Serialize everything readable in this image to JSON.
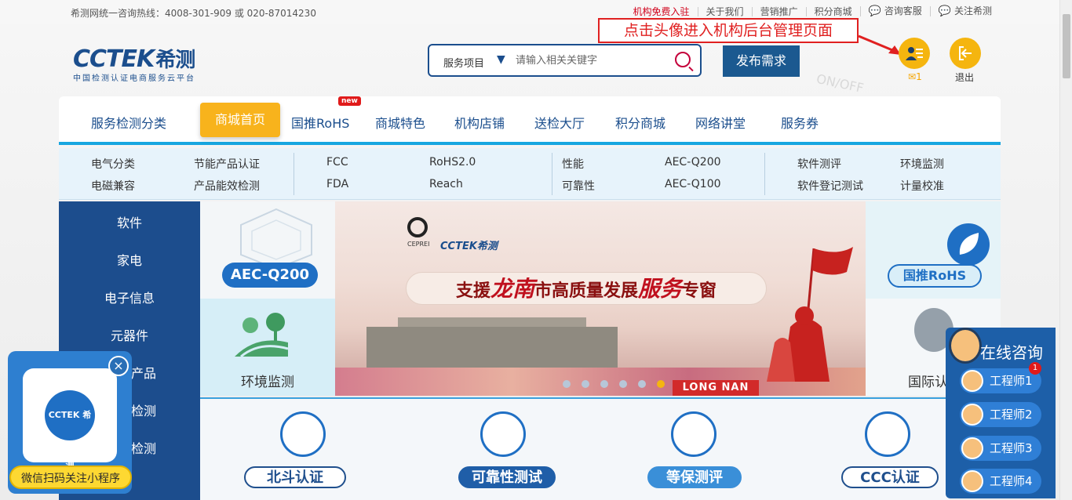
{
  "topbar": {
    "hotline": "希测网统一咨询热线：4008-301-909 或 020-87014230",
    "links": [
      "机构免费入驻",
      "关于我们",
      "营销推广",
      "积分商城"
    ],
    "consult": "咨询客服",
    "follow": "关注希测"
  },
  "logo": {
    "mark": "CCTEK",
    "cn": "希测",
    "tagline": "中国检测认证电商服务云平台"
  },
  "search": {
    "service_label": "服务项目",
    "placeholder": "请输入相关关键字"
  },
  "publish_label": "发布需求",
  "callout": "点击头像进入机构后台管理页面",
  "user": {
    "mail_count": "1",
    "logout_label": "退出"
  },
  "watermark": "ON/OFF",
  "nav": {
    "category": "服务检测分类",
    "items": [
      "商城首页",
      "国推RoHS",
      "商城特色",
      "机构店铺",
      "送检大厅",
      "积分商城",
      "网络讲堂",
      "服务券"
    ],
    "new_badge": "new"
  },
  "subnav": {
    "col1": [
      "电气分类",
      "电磁兼容"
    ],
    "col2": [
      "节能产品认证",
      "产品能效检测"
    ],
    "col3": [
      "FCC",
      "FDA"
    ],
    "col4": [
      "RoHS2.0",
      "Reach"
    ],
    "col5": [
      "性能",
      "可靠性"
    ],
    "col6": [
      "AEC-Q200",
      "AEC-Q100"
    ],
    "col7": [
      "软件测评",
      "软件登记测试"
    ],
    "col8": [
      "环境监测",
      "计量校准"
    ]
  },
  "sidebar": [
    "软件",
    "家电",
    "电子信息",
    "元器件",
    "产品",
    "检测",
    "检测"
  ],
  "tiles": {
    "aec": "AEC-Q200",
    "env": "环境监测",
    "rohs": "国推RoHS",
    "intl": "国际认"
  },
  "banner": {
    "brand1": "CEPREI",
    "brand2": "CCTEK希测",
    "slogan_a": "支援",
    "slogan_hl1": "龙南",
    "slogan_b": "市高质量发展",
    "slogan_hl2": "服务",
    "slogan_c": "专窗",
    "longnan": "LONG NAN"
  },
  "cards": [
    "北斗认证",
    "可靠性测试",
    "等保测评",
    "CCC认证"
  ],
  "miniprogram": {
    "qr_label": "CCTEK 希测",
    "close": "×",
    "cta": "微信扫码关注小程序"
  },
  "consult": {
    "title": "在线咨询",
    "badge": "1",
    "engineers": [
      "工程师1",
      "工程师2",
      "工程师3",
      "工程师4"
    ]
  }
}
